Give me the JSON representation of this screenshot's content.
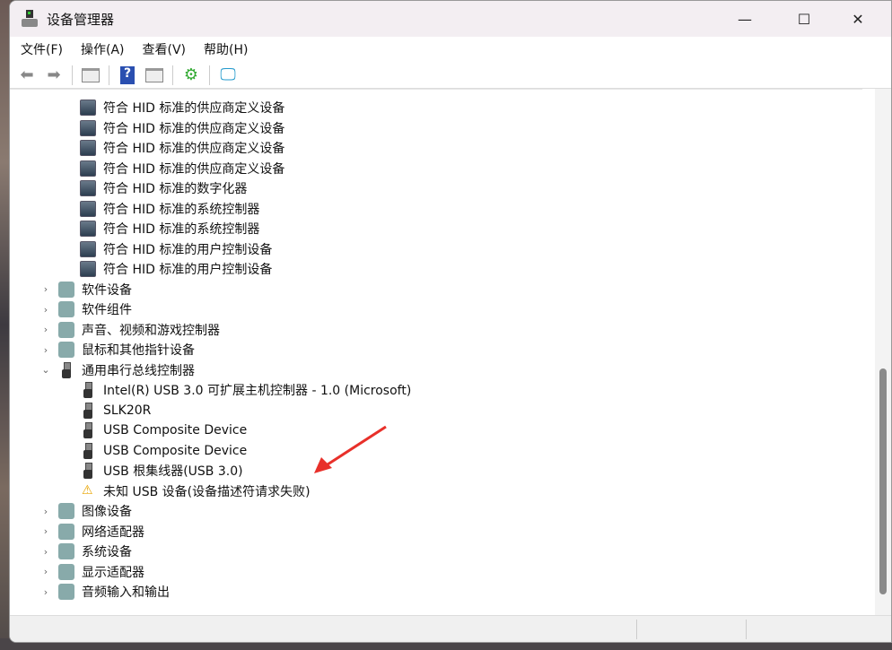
{
  "window": {
    "title": "设备管理器",
    "minimize": "—",
    "maximize": "☐",
    "close": "✕"
  },
  "menu": [
    "文件(F)",
    "操作(A)",
    "查看(V)",
    "帮助(H)"
  ],
  "toolbar": [
    "back-icon",
    "forward-icon",
    "console-tree-icon",
    "help-icon",
    "action-pane-icon",
    "update-driver-icon",
    "scan-hardware-icon"
  ],
  "tree": [
    {
      "label": "符合 HID 标准的供应商定义设备",
      "level": 2,
      "icon": "hid"
    },
    {
      "label": "符合 HID 标准的供应商定义设备",
      "level": 2,
      "icon": "hid"
    },
    {
      "label": "符合 HID 标准的供应商定义设备",
      "level": 2,
      "icon": "hid"
    },
    {
      "label": "符合 HID 标准的供应商定义设备",
      "level": 2,
      "icon": "hid"
    },
    {
      "label": "符合 HID 标准的数字化器",
      "level": 2,
      "icon": "hid"
    },
    {
      "label": "符合 HID 标准的系统控制器",
      "level": 2,
      "icon": "hid"
    },
    {
      "label": "符合 HID 标准的系统控制器",
      "level": 2,
      "icon": "hid"
    },
    {
      "label": "符合 HID 标准的用户控制设备",
      "level": 2,
      "icon": "hid"
    },
    {
      "label": "符合 HID 标准的用户控制设备",
      "level": 2,
      "icon": "hid"
    },
    {
      "label": "软件设备",
      "level": 1,
      "icon": "cat",
      "expanded": false
    },
    {
      "label": "软件组件",
      "level": 1,
      "icon": "cat",
      "expanded": false
    },
    {
      "label": "声音、视频和游戏控制器",
      "level": 1,
      "icon": "cat",
      "expanded": false
    },
    {
      "label": "鼠标和其他指针设备",
      "level": 1,
      "icon": "cat",
      "expanded": false
    },
    {
      "label": "通用串行总线控制器",
      "level": 1,
      "icon": "usb",
      "expanded": true
    },
    {
      "label": "Intel(R) USB 3.0 可扩展主机控制器 - 1.0 (Microsoft)",
      "level": 2,
      "icon": "usb"
    },
    {
      "label": "SLK20R",
      "level": 2,
      "icon": "usb"
    },
    {
      "label": "USB Composite Device",
      "level": 2,
      "icon": "usb"
    },
    {
      "label": "USB Composite Device",
      "level": 2,
      "icon": "usb"
    },
    {
      "label": "USB 根集线器(USB 3.0)",
      "level": 2,
      "icon": "usb"
    },
    {
      "label": "未知 USB 设备(设备描述符请求失败)",
      "level": 2,
      "icon": "warn"
    },
    {
      "label": "图像设备",
      "level": 1,
      "icon": "cat",
      "expanded": false
    },
    {
      "label": "网络适配器",
      "level": 1,
      "icon": "cat",
      "expanded": false
    },
    {
      "label": "系统设备",
      "level": 1,
      "icon": "cat",
      "expanded": false
    },
    {
      "label": "显示适配器",
      "level": 1,
      "icon": "cat",
      "expanded": false
    },
    {
      "label": "音频输入和输出",
      "level": 1,
      "icon": "cat",
      "expanded": false
    }
  ],
  "annotation_color": "#e8302a"
}
